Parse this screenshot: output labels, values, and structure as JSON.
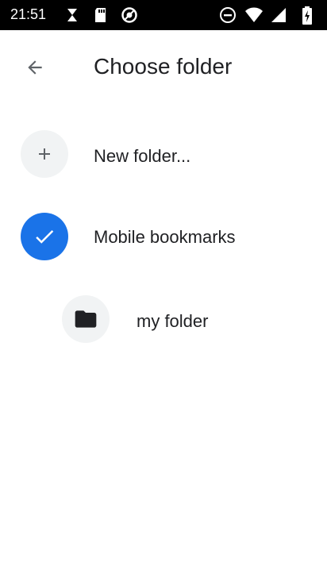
{
  "status_bar": {
    "time": "21:51",
    "icons": [
      "sync-off-icon",
      "sd-card-icon",
      "do-not-disturb-off-icon",
      "minus-circle-icon",
      "wifi-icon",
      "signal-icon",
      "battery-charging-icon"
    ]
  },
  "header": {
    "title": "Choose folder",
    "back_icon": "arrow-back-icon"
  },
  "folders": {
    "new_folder_label": "New folder...",
    "items": [
      {
        "label": "Mobile bookmarks",
        "selected": true,
        "icon": "check-icon"
      },
      {
        "label": "my folder",
        "selected": false,
        "icon": "folder-icon"
      }
    ]
  },
  "colors": {
    "accent": "#1a73e8",
    "icon_bg": "#f1f3f4",
    "text_primary": "#202124",
    "icon_gray": "#5f6368"
  }
}
